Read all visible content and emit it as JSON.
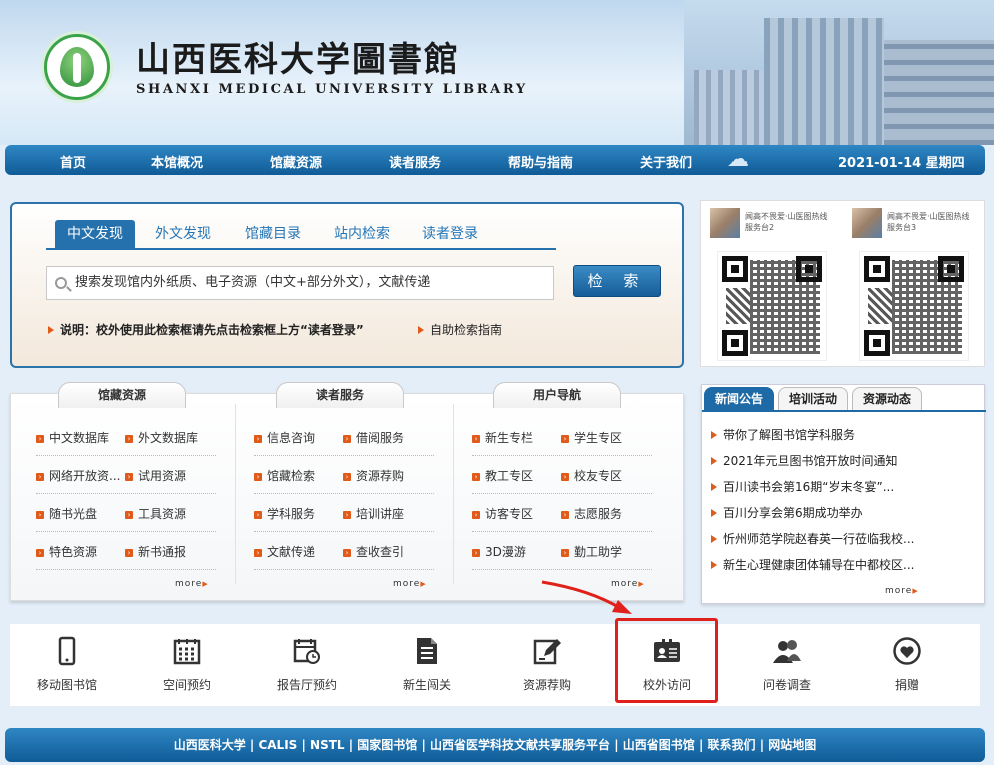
{
  "header": {
    "title_cn": "山西医科大学圖書館",
    "title_en": "SHANXI MEDICAL UNIVERSITY LIBRARY"
  },
  "nav": {
    "items": [
      "首页",
      "本馆概况",
      "馆藏资源",
      "读者服务",
      "帮助与指南",
      "关于我们"
    ],
    "date": "2021-01-14 星期四"
  },
  "search": {
    "tabs": [
      "中文发现",
      "外文发现",
      "馆藏目录",
      "站内检索",
      "读者登录"
    ],
    "placeholder": "搜索发现馆内外纸质、电子资源（中文+部分外文），文献传递",
    "button": "检 索",
    "tip": "说明：校外使用此检索框请先点击检索框上方“读者登录”",
    "guide": "自助检索指南"
  },
  "qr": [
    {
      "caption": "闻高不畏爱·山医图热线服务台2"
    },
    {
      "caption": "闻高不畏爱·山医图热线服务台3"
    }
  ],
  "categories": {
    "collections": {
      "title": "馆藏资源",
      "items": [
        "中文数据库",
        "外文数据库",
        "网络开放资...",
        "试用资源",
        "随书光盘",
        "工具资源",
        "特色资源",
        "新书通报"
      ]
    },
    "services": {
      "title": "读者服务",
      "items": [
        "信息咨询",
        "借阅服务",
        "馆藏检索",
        "资源荐购",
        "学科服务",
        "培训讲座",
        "文献传递",
        "查收查引"
      ]
    },
    "guide": {
      "title": "用户导航",
      "items": [
        "新生专栏",
        "学生专区",
        "教工专区",
        "校友专区",
        "访客专区",
        "志愿服务",
        "3D漫游",
        "勤工助学"
      ]
    },
    "more": "more"
  },
  "news": {
    "tabs": [
      "新闻公告",
      "培训活动",
      "资源动态"
    ],
    "items": [
      "带你了解图书馆学科服务",
      "2021年元旦图书馆开放时间通知",
      "百川读书会第16期“岁末冬宴”...",
      "百川分享会第6期成功举办",
      "忻州师范学院赵春英一行莅临我校...",
      "新生心理健康团体辅导在中都校区..."
    ],
    "more": "more"
  },
  "quick": [
    {
      "label": "移动图书馆",
      "icon": "mobile-phone-icon"
    },
    {
      "label": "空间预约",
      "icon": "calendar-grid-icon"
    },
    {
      "label": "报告厅预约",
      "icon": "calendar-clock-icon"
    },
    {
      "label": "新生闯关",
      "icon": "document-icon"
    },
    {
      "label": "资源荐购",
      "icon": "edit-document-icon"
    },
    {
      "label": "校外访问",
      "icon": "id-card-icon"
    },
    {
      "label": "问卷调查",
      "icon": "users-icon"
    },
    {
      "label": "捐赠",
      "icon": "heart-icon"
    }
  ],
  "footer": "山西医科大学 | CALIS | NSTL | 国家图书馆 | 山西省医学科技文献共享服务平台 | 山西省图书馆 | 联系我们 | 网站地图",
  "colors": {
    "nav": "#1a6aa8",
    "accent": "#e05a1a",
    "highlight": "#e0201a"
  }
}
